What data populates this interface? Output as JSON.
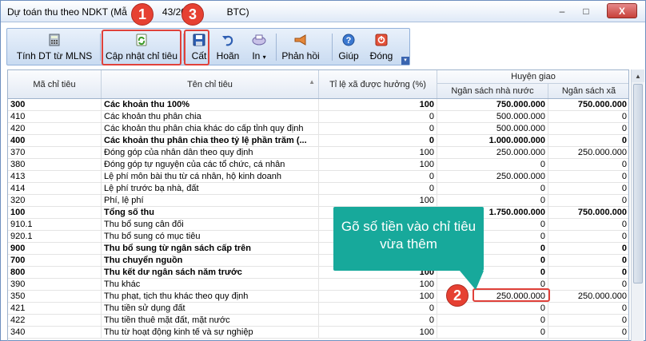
{
  "window": {
    "title_visible_left": "Dự toán thu theo NDKT (Mẫ",
    "title_visible_mid": "43/201",
    "title_visible_right": "BTC)",
    "minimize": "–",
    "maximize": "□",
    "close": "X"
  },
  "toolbar": {
    "buttons": [
      {
        "label": "Tính DT từ MLNS",
        "icon": "calculator-icon"
      },
      {
        "label": "Cập nhật chỉ tiêu",
        "icon": "refresh-icon"
      },
      {
        "label": "Cất",
        "icon": "save-icon"
      },
      {
        "label": "Hoãn",
        "icon": "undo-icon"
      },
      {
        "label": "In",
        "icon": "print-icon"
      },
      {
        "label": "Phản hồi",
        "icon": "megaphone-icon"
      },
      {
        "label": "Giúp",
        "icon": "help-icon"
      },
      {
        "label": "Đóng",
        "icon": "close-icon"
      }
    ],
    "dropdown_glyph": "▾",
    "grip_glyph": "▾"
  },
  "grid": {
    "headers": {
      "ma_chi_tieu": "Mã chỉ tiêu",
      "ten_chi_tieu": "Tên chỉ tiêu",
      "sort_glyph": "▲",
      "ti_le": "Tỉ lệ xã được hưởng (%)",
      "huyen_giao": "Huyện giao",
      "ngan_sach_nha_nuoc": "Ngân sách nhà nước",
      "ngan_sach_xa": "Ngân sách xã"
    },
    "rows": [
      {
        "ma": "300",
        "ten": "Các khoản thu 100%",
        "tile": "100",
        "nsnn": "750.000.000",
        "nsx": "750.000.000",
        "bold": true
      },
      {
        "ma": "410",
        "ten": "Các khoản thu phân chia",
        "tile": "0",
        "nsnn": "500.000.000",
        "nsx": "0",
        "bold": false
      },
      {
        "ma": "420",
        "ten": "Các khoản thu phân chia khác do cấp tỉnh quy định",
        "tile": "0",
        "nsnn": "500.000.000",
        "nsx": "0",
        "bold": false
      },
      {
        "ma": "400",
        "ten": "Các khoản thu phân chia theo tỷ lệ phần trăm (...",
        "tile": "0",
        "nsnn": "1.000.000.000",
        "nsx": "0",
        "bold": true
      },
      {
        "ma": "370",
        "ten": "Đóng góp của nhân dân theo quy định",
        "tile": "100",
        "nsnn": "250.000.000",
        "nsx": "250.000.000",
        "bold": false
      },
      {
        "ma": "380",
        "ten": "Đóng góp tự nguyện của các tổ chức, cá nhân",
        "tile": "100",
        "nsnn": "0",
        "nsx": "0",
        "bold": false
      },
      {
        "ma": "413",
        "ten": "Lệ phí môn bài thu từ cá nhân, hộ kinh doanh",
        "tile": "0",
        "nsnn": "250.000.000",
        "nsx": "0",
        "bold": false
      },
      {
        "ma": "414",
        "ten": "Lệ phí trước bạ nhà, đất",
        "tile": "0",
        "nsnn": "0",
        "nsx": "0",
        "bold": false
      },
      {
        "ma": "320",
        "ten": "Phí, lệ phí",
        "tile": "100",
        "nsnn": "0",
        "nsx": "0",
        "bold": false
      },
      {
        "ma": "100",
        "ten": "Tổng số thu",
        "tile": "",
        "nsnn": "1.750.000.000",
        "nsx": "750.000.000",
        "bold": true
      },
      {
        "ma": "910.1",
        "ten": "Thu bổ sung cân đối",
        "tile": "",
        "nsnn": "0",
        "nsx": "0",
        "bold": false
      },
      {
        "ma": "920.1",
        "ten": "Thu bổ sung có mục tiêu",
        "tile": "",
        "nsnn": "0",
        "nsx": "0",
        "bold": false
      },
      {
        "ma": "900",
        "ten": "Thu bổ sung từ ngân sách cấp trên",
        "tile": "",
        "nsnn": "0",
        "nsx": "0",
        "bold": true
      },
      {
        "ma": "700",
        "ten": "Thu chuyển nguồn",
        "tile": "",
        "nsnn": "0",
        "nsx": "0",
        "bold": true
      },
      {
        "ma": "800",
        "ten": "Thu kết dư ngân sách năm trước",
        "tile": "100",
        "nsnn": "0",
        "nsx": "0",
        "bold": true
      },
      {
        "ma": "390",
        "ten": "Thu khác",
        "tile": "100",
        "nsnn": "0",
        "nsx": "0",
        "bold": false
      },
      {
        "ma": "350",
        "ten": "Thu phạt, tịch thu khác theo quy định",
        "tile": "100",
        "nsnn": "250.000.000",
        "nsx": "250.000.000",
        "bold": false
      },
      {
        "ma": "421",
        "ten": "Thu tiền sử dụng đất",
        "tile": "0",
        "nsnn": "0",
        "nsx": "0",
        "bold": false
      },
      {
        "ma": "422",
        "ten": "Thu tiền thuê mặt đất, mặt nước",
        "tile": "0",
        "nsnn": "0",
        "nsx": "0",
        "bold": false
      },
      {
        "ma": "340",
        "ten": "Thu từ hoạt động kinh tế và sự nghiệp",
        "tile": "100",
        "nsnn": "0",
        "nsx": "0",
        "bold": false
      }
    ]
  },
  "annotations": {
    "badge1": "1",
    "badge2": "2",
    "badge3": "3",
    "callout_text": "Gõ số tiền vào chỉ tiêu vừa thêm"
  },
  "colors": {
    "badge_red": "#e64032",
    "callout_teal": "#17a99b",
    "toolbar_blue": "#c9dbf1"
  }
}
